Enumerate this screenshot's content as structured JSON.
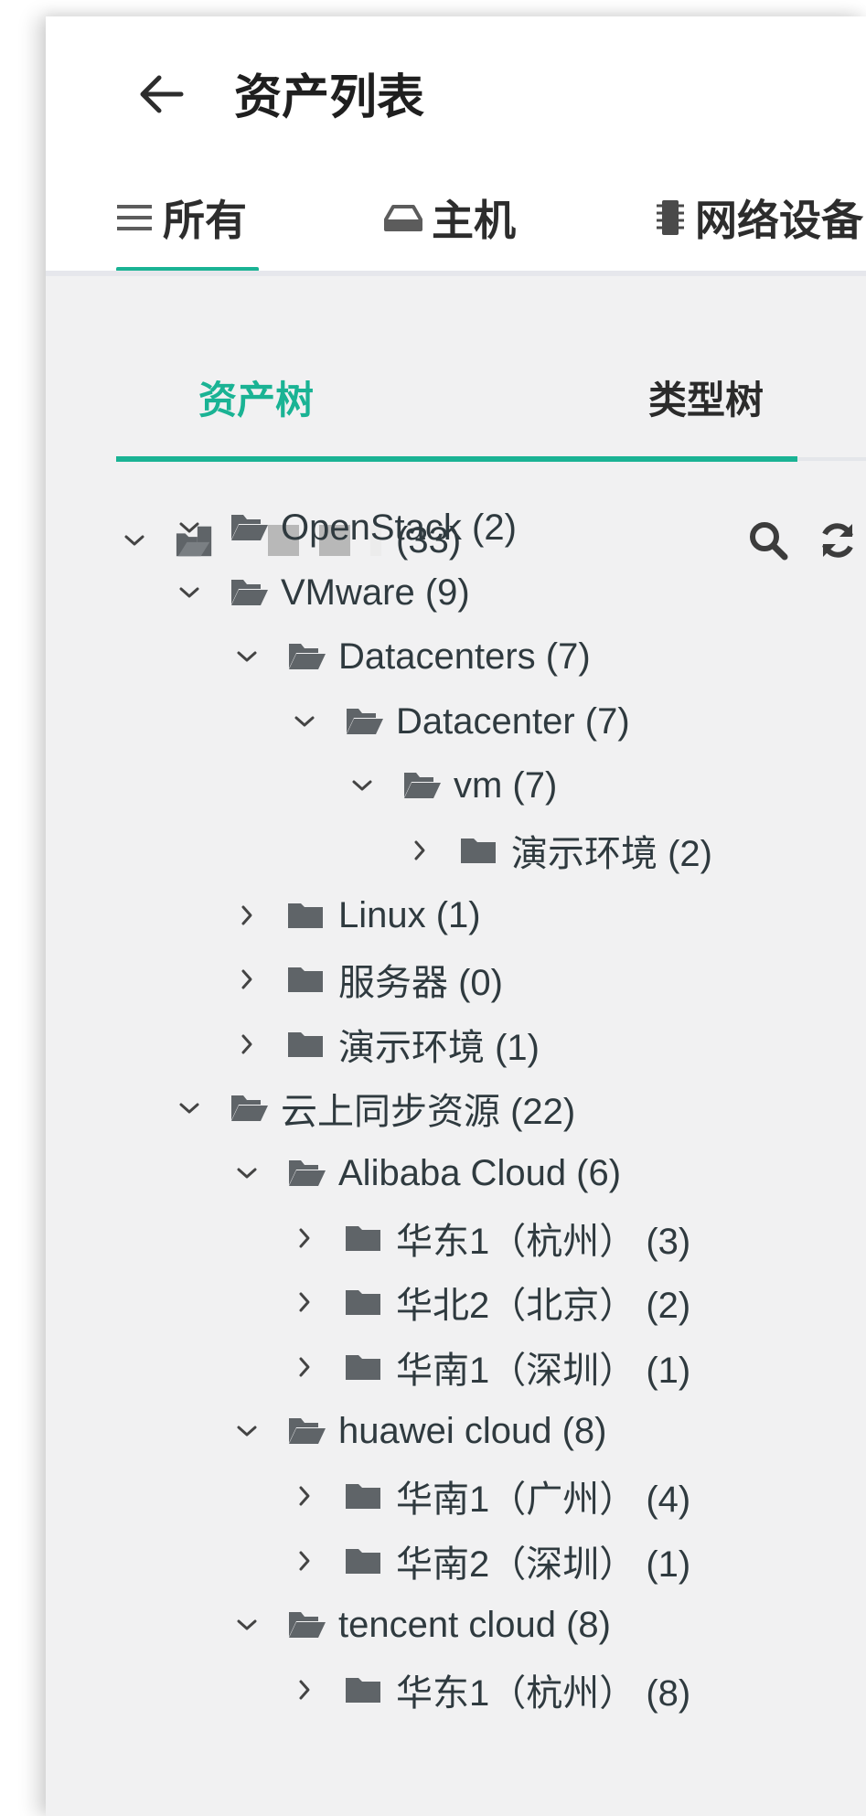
{
  "header": {
    "title": "资产列表",
    "tabs": [
      {
        "label": "所有",
        "icon": "list-icon"
      },
      {
        "label": "主机",
        "icon": "hard-drive-icon"
      },
      {
        "label": "网络设备",
        "icon": "network-device-icon"
      }
    ],
    "active_tab": 0
  },
  "tree_tabs": [
    "资产树",
    "类型树"
  ],
  "active_tree_tab": 0,
  "tree": {
    "root_count": "(33)",
    "nodes": [
      {
        "label": "OpenStack (2)",
        "level": 1,
        "expanded": true
      },
      {
        "label": "VMware (9)",
        "level": 1,
        "expanded": true
      },
      {
        "label": "Datacenters (7)",
        "level": 2,
        "expanded": true
      },
      {
        "label": "Datacenter (7)",
        "level": 3,
        "expanded": true
      },
      {
        "label": "vm (7)",
        "level": 4,
        "expanded": true
      },
      {
        "label": "演示环境 (2)",
        "level": 5,
        "expanded": false
      },
      {
        "label": "Linux (1)",
        "level": 2,
        "expanded": false
      },
      {
        "label": "服务器 (0)",
        "level": 2,
        "expanded": false
      },
      {
        "label": "演示环境 (1)",
        "level": 2,
        "expanded": false
      },
      {
        "label": "云上同步资源 (22)",
        "level": 1,
        "expanded": true
      },
      {
        "label": "Alibaba Cloud (6)",
        "level": 2,
        "expanded": true
      },
      {
        "label": "华东1（杭州） (3)",
        "level": 3,
        "expanded": false
      },
      {
        "label": "华北2（北京） (2)",
        "level": 3,
        "expanded": false
      },
      {
        "label": "华南1（深圳） (1)",
        "level": 3,
        "expanded": false
      },
      {
        "label": "huawei cloud (8)",
        "level": 2,
        "expanded": true
      },
      {
        "label": "华南1（广州） (4)",
        "level": 3,
        "expanded": false
      },
      {
        "label": "华南2（深圳） (1)",
        "level": 3,
        "expanded": false
      },
      {
        "label": "tencent cloud (8)",
        "level": 2,
        "expanded": true
      },
      {
        "label": "华东1（杭州） (8)",
        "level": 3,
        "expanded": false
      }
    ]
  },
  "colors": {
    "accent": "#1ab394",
    "icon": "#5f6468",
    "background": "#f1f1f2"
  }
}
